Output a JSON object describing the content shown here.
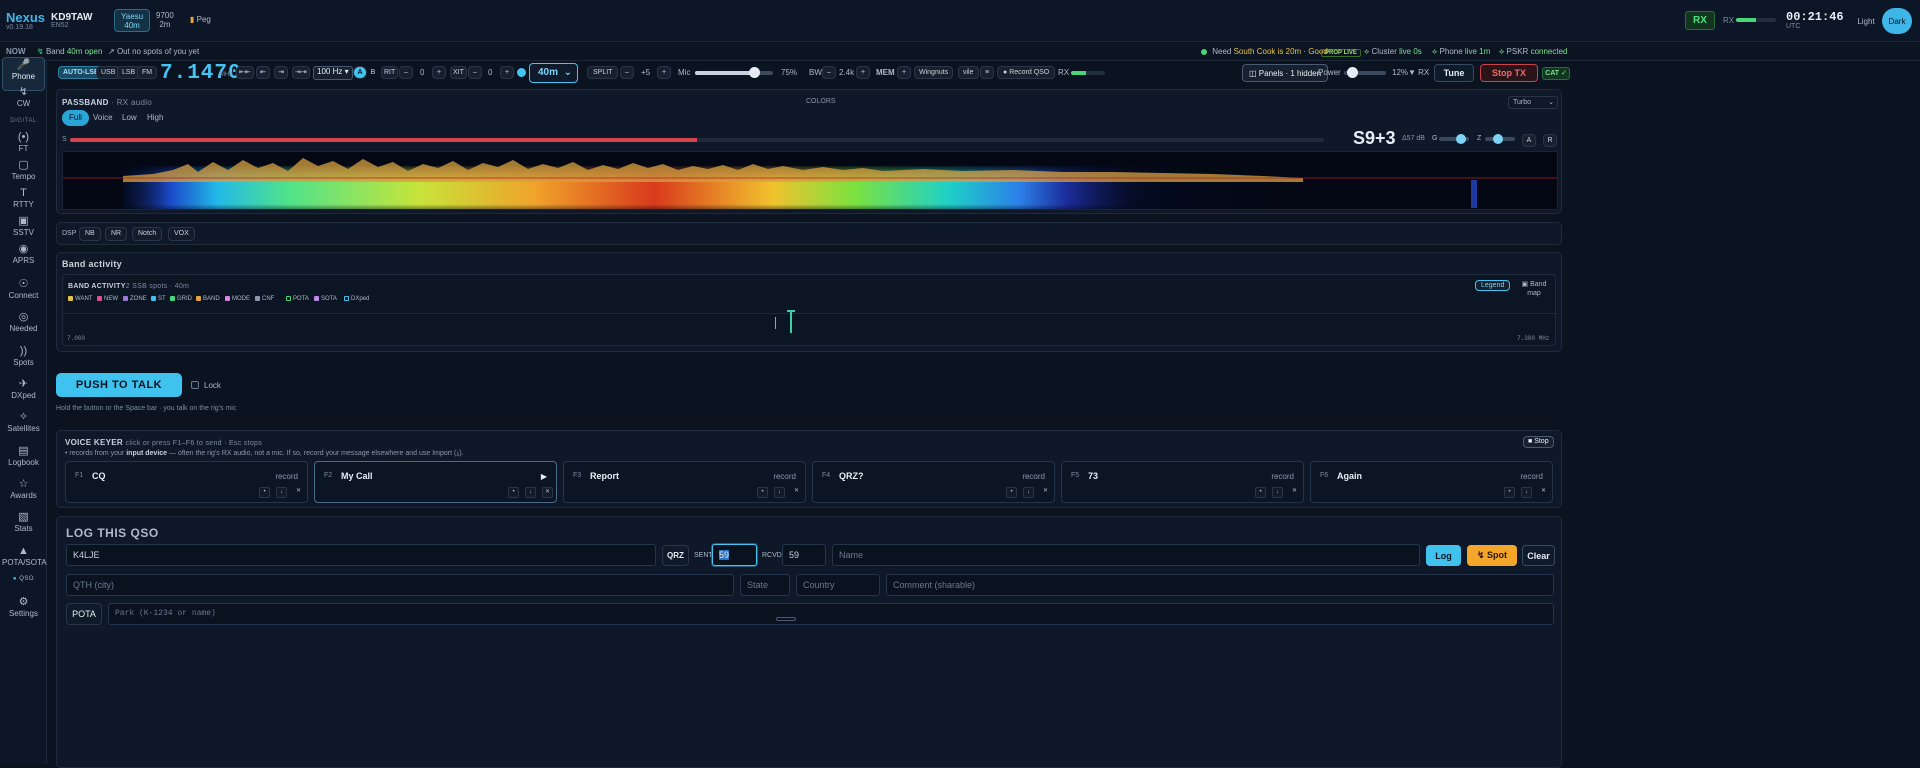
{
  "app": {
    "name": "Nexus",
    "version": "v0.19.18",
    "callsign": "KD9TAW",
    "grid": "EN52"
  },
  "rigs": [
    {
      "name": "Yaesu",
      "band": "40m"
    },
    {
      "name": "9700",
      "band": "2m"
    },
    {
      "name": "Peg"
    }
  ],
  "header": {
    "rx_badge": "RX",
    "rx_label": "RX",
    "rx_level": 0.5,
    "clock": "00:21:46",
    "clock_zone": "UTC",
    "theme_light": "Light",
    "theme_dark": "Dark"
  },
  "statusbar": {
    "now": "NOW",
    "band_label": "Band",
    "band_value": "40m open",
    "out_label": "Out",
    "out_value": "no spots of you yet",
    "need_label": "Need",
    "need_value": "South Cook is 20m · Good",
    "prop_live": "PROP LIVE",
    "cluster_label": "Cluster",
    "cluster_value": "live 0s",
    "phone_label": "Phone",
    "phone_value": "live 1m",
    "pskr_label": "PSKR",
    "pskr_value": "connected"
  },
  "nav": {
    "items": [
      {
        "label": "Phone",
        "icon": "mic-icon"
      },
      {
        "label": "CW",
        "icon": "morse-icon"
      },
      {
        "label": "FT",
        "icon": "ft-icon"
      },
      {
        "label": "Tempo",
        "icon": "tempo-icon"
      },
      {
        "label": "RTTY",
        "icon": "rtty-icon"
      },
      {
        "label": "SSTV",
        "icon": "sstv-icon"
      },
      {
        "label": "APRS",
        "icon": "aprs-icon"
      },
      {
        "label": "Connect",
        "icon": "connect-icon"
      },
      {
        "label": "Needed",
        "icon": "needed-icon"
      },
      {
        "label": "Spots",
        "icon": "spots-icon"
      },
      {
        "label": "DXped",
        "icon": "dxped-icon"
      },
      {
        "label": "Satellites",
        "icon": "satellite-icon"
      },
      {
        "label": "Logbook",
        "icon": "logbook-icon"
      },
      {
        "label": "Awards",
        "icon": "awards-icon"
      },
      {
        "label": "Stats",
        "icon": "stats-icon"
      },
      {
        "label": "POTA/SOTA",
        "icon": "pota-icon"
      },
      {
        "label": "Settings",
        "icon": "gear-icon"
      }
    ],
    "digital_section": "DIGITAL",
    "qso_label": "QSO"
  },
  "rig": {
    "modes": [
      "AUTO-LSB",
      "USB",
      "LSB",
      "FM"
    ],
    "frequency": "7.1470",
    "freq_unit": "MHz",
    "step": "100 Hz",
    "vfo_a": "A",
    "vfo_b": "B",
    "rit_label": "RIT",
    "rit_value": "0",
    "xit_label": "XIT",
    "xit_value": "0",
    "band": "40m",
    "split_label": "SPLIT",
    "split_offset": "+5",
    "mic_label": "Mic",
    "mic_value": "75%",
    "mic_level": 0.75,
    "bw_label": "BW",
    "bw_value": "2.4k",
    "mem_label": "MEM",
    "mem_name1": "Wingnuts",
    "mem_name2": "vile",
    "record_qso": "Record QSO",
    "rx_label": "RX",
    "rx_level": 0.45,
    "panels": "Panels · 1 hidden",
    "power_label": "Power",
    "power_value": "12%",
    "power_level": 0.12,
    "rx_filter": "RX",
    "tune": "Tune",
    "stop_tx": "Stop TX",
    "cat": "CAT"
  },
  "passband": {
    "title": "PASSBAND",
    "subtitle": "· RX audio",
    "colors_label": "COLORS",
    "palette": "Turbo",
    "filters": [
      "Full",
      "Voice",
      "Low",
      "High"
    ],
    "s_label": "S",
    "smeter_level": 0.5,
    "reading": "S9+3",
    "delta": "Δ57 dB",
    "g_label": "G",
    "z_label": "Z",
    "a_label": "A",
    "r_label": "R"
  },
  "dsp": {
    "label": "DSP",
    "buttons": [
      "NB",
      "NR",
      "Notch",
      "VOX"
    ]
  },
  "band_activity": {
    "section_title": "Band activity",
    "title": "BAND ACTIVITY",
    "subtitle": "2 SSB spots · 40m",
    "legend_button": "Legend",
    "band_map_button": "Band map",
    "legend": [
      {
        "label": "WANT",
        "color": "#e7c24b"
      },
      {
        "label": "NEW",
        "color": "#e0508f"
      },
      {
        "label": "ZONE",
        "color": "#9a7ad8"
      },
      {
        "label": "ST",
        "color": "#3fc2ee"
      },
      {
        "label": "GRID",
        "color": "#49d57a"
      },
      {
        "label": "BAND",
        "color": "#e7a23b"
      },
      {
        "label": "MODE",
        "color": "#d88ae0"
      },
      {
        "label": "CNF",
        "color": "#8b98ac"
      },
      {
        "label": "POTA",
        "color": "#49d57a"
      },
      {
        "label": "SOTA",
        "color": "#c08ae8"
      },
      {
        "label": "DXped",
        "color": "#3fc2ee"
      }
    ],
    "range_start": "7.000",
    "range_end": "7.300 MHz"
  },
  "ptt": {
    "button": "PUSH TO TALK",
    "lock": "Lock",
    "hint": "Hold the button or the Space bar · you talk on the rig's mic"
  },
  "keyer": {
    "title": "VOICE KEYER",
    "subtitle": "click or press F1–F6 to send · Esc stops",
    "stop": "Stop",
    "note_pre": "records from your",
    "note_bold": "input device",
    "note_post": "— often the rig's RX audio, not a mic. If so, record your message elsewhere and use Import (⤓).",
    "slots": [
      {
        "key": "F1",
        "name": "CQ",
        "action": "record"
      },
      {
        "key": "F2",
        "name": "My Call",
        "action": "▶"
      },
      {
        "key": "F3",
        "name": "Report",
        "action": "record"
      },
      {
        "key": "F4",
        "name": "QRZ?",
        "action": "record"
      },
      {
        "key": "F5",
        "name": "73",
        "action": "record"
      },
      {
        "key": "F6",
        "name": "Again",
        "action": "record"
      }
    ]
  },
  "log": {
    "title": "LOG THIS QSO",
    "call_value": "K4LJE",
    "qrz": "QRZ",
    "sent_label": "SENT",
    "sent_value": "59",
    "rcvd_label": "RCVD",
    "rcvd_value": "59",
    "name_placeholder": "Name",
    "log_button": "Log",
    "spot_button": "Spot",
    "clear_button": "Clear",
    "qth_placeholder": "QTH (city)",
    "state_placeholder": "State",
    "country_placeholder": "Country",
    "comment_placeholder": "Comment (sharable)",
    "pota_label": "POTA",
    "park_placeholder": "Park (K-1234 or name)"
  }
}
